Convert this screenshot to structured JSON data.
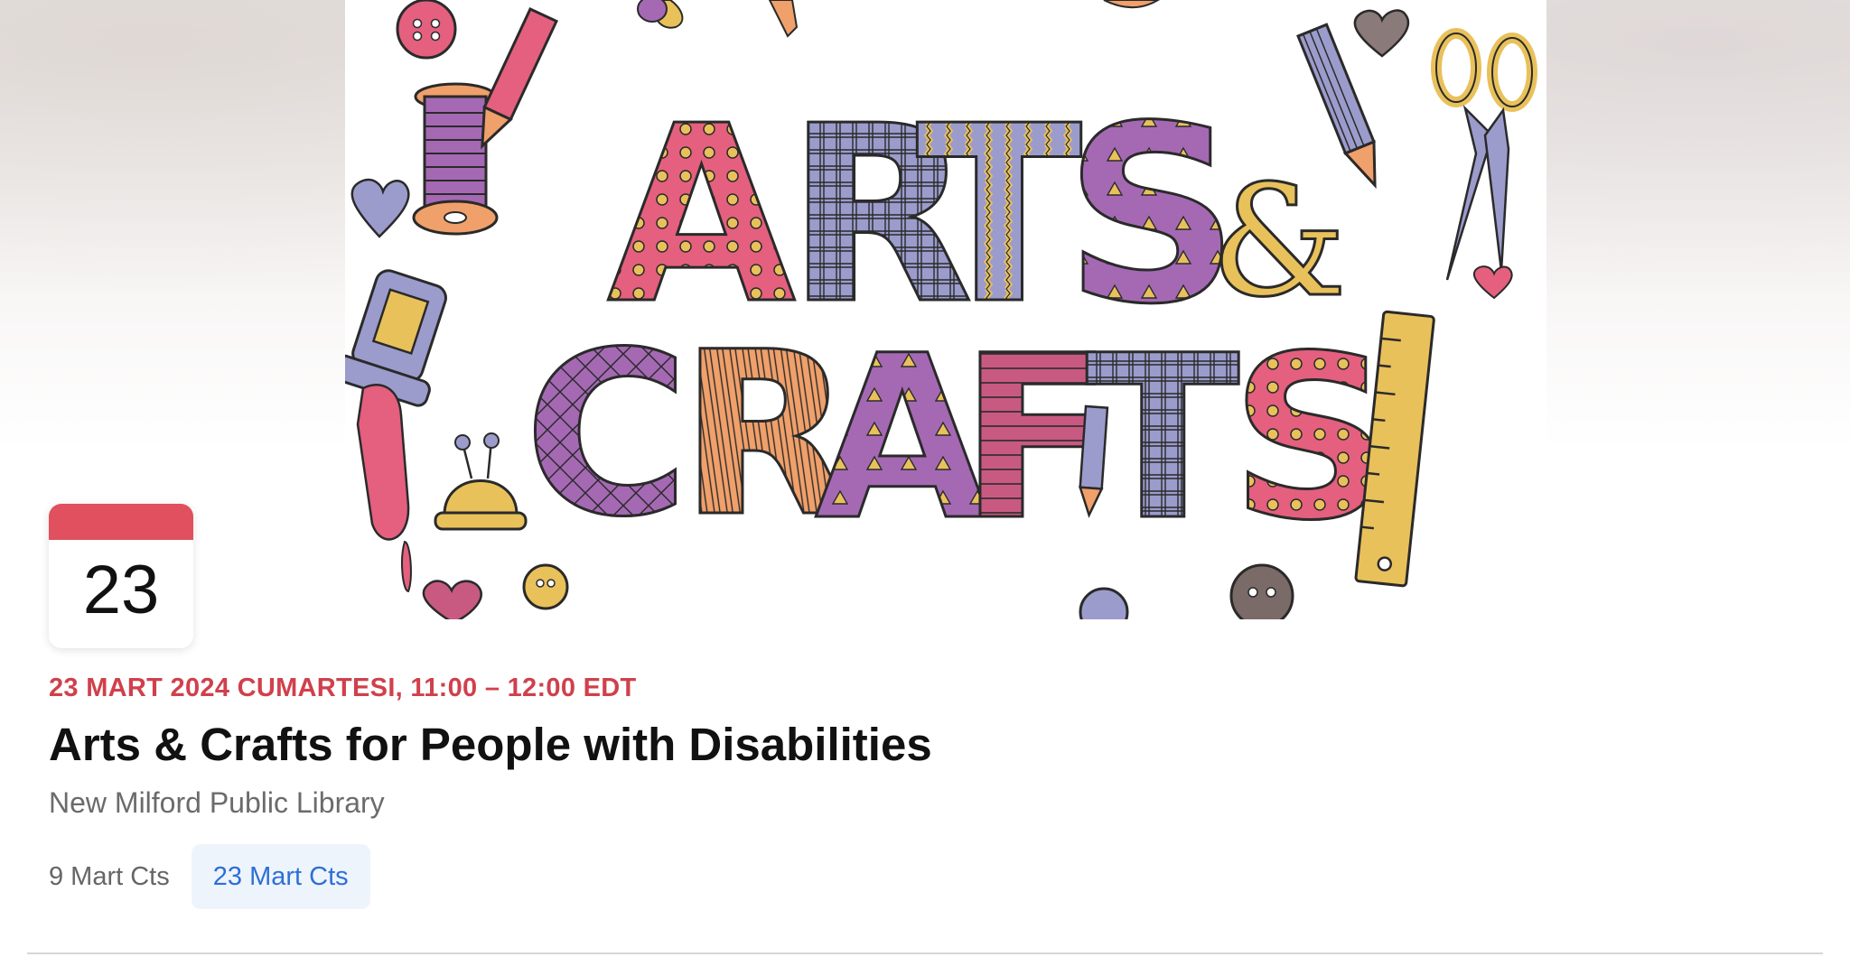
{
  "calendar_tile": {
    "day": "23",
    "accent_color": "#e0505e"
  },
  "event": {
    "date_time": "23 MART 2024 CUMARTESI, 11:00 – 12:00 EDT",
    "title": "Arts & Crafts for People with Disabilities",
    "location": "New Milford Public Library"
  },
  "artwork": {
    "line1": "ARTS",
    "ampersand": "&",
    "line2": "CRAFTS",
    "exclamation": "!",
    "icons": [
      "button-icon",
      "thread-spool-icon",
      "pencil-icon",
      "scissors-icon",
      "glue-bottle-icon",
      "pincushion-icon",
      "ruler-icon",
      "heart-icon"
    ]
  },
  "date_chips": [
    {
      "label": "9 Mart Cts",
      "selected": false
    },
    {
      "label": "23 Mart Cts",
      "selected": true
    }
  ],
  "colors": {
    "date_text": "#d0404c",
    "selected_chip_text": "#2e6fd6",
    "selected_chip_bg": "#eef4fc",
    "pink": "#e4607e",
    "purple": "#a569b4",
    "lavender": "#9b9ccc",
    "yellow": "#e9c15b",
    "orange": "#f0a06a"
  }
}
